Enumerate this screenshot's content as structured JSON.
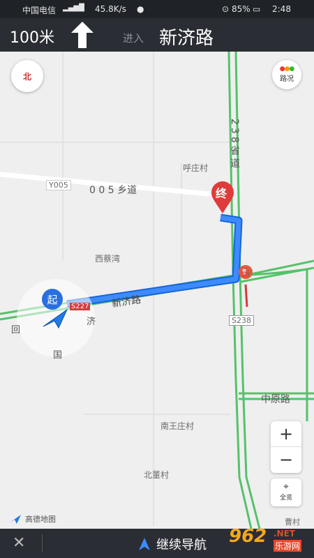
{
  "status_bar": {
    "carrier": "中国电信",
    "speed": "45.8K/s",
    "battery": "85%",
    "time": "2:48"
  },
  "nav": {
    "distance": "100米",
    "enter": "进入",
    "road": "新济路"
  },
  "map": {
    "compass_label": "北",
    "traffic_label": "路况",
    "start_label": "起",
    "end_label": "终",
    "zoom_in": "+",
    "zoom_out": "−",
    "overview_label": "全览",
    "logo": "高德地图",
    "labels": {
      "village_hu": "呼庄村",
      "y005": "Y005",
      "road_005": "0 0 5 乡道",
      "xicai": "西蔡湾",
      "s238": "S238",
      "zhongyuan": "中原路",
      "nanwang": "南王庄村",
      "beidong": "北董村",
      "cao": "曹村",
      "route_road": "新济路",
      "r238": "238省道",
      "hui": "回",
      "ji": "济",
      "guo": "国",
      "s227": "S227"
    }
  },
  "bottom": {
    "close": "✕",
    "continue": "继续导航"
  },
  "watermark": {
    "brand": "962",
    "suffix": ".NET",
    "sub": "乐游网"
  }
}
